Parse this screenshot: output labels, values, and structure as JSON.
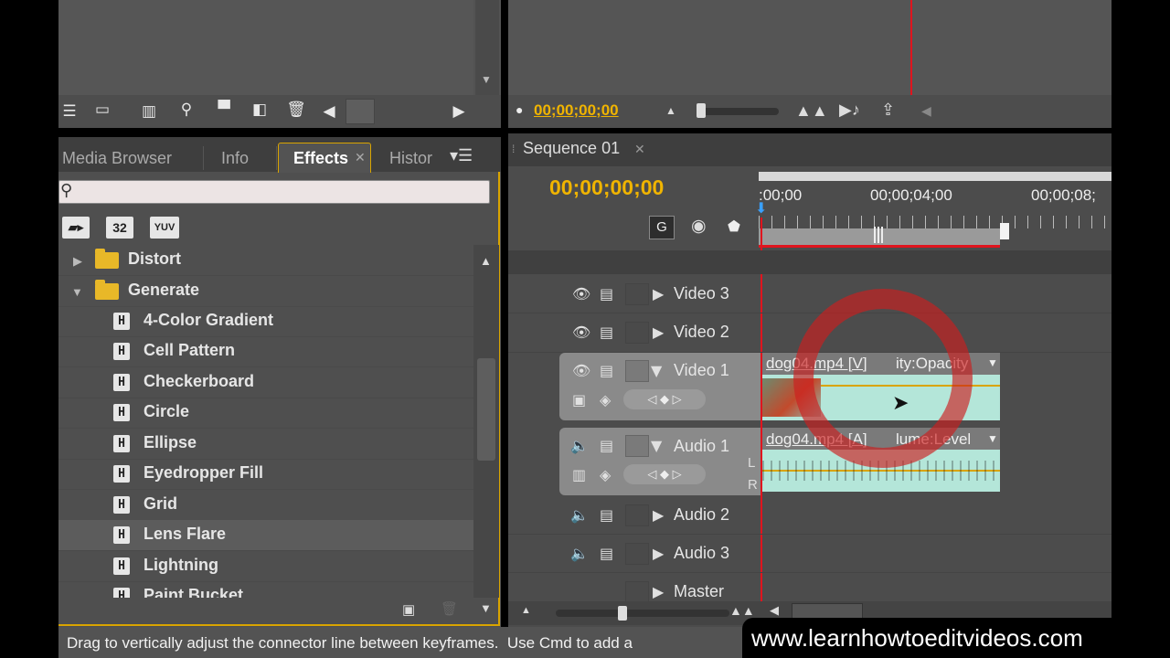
{
  "project_panel": {
    "timecode": "00;00;00;00"
  },
  "effects_panel": {
    "tabs": [
      {
        "label": "Media Browser"
      },
      {
        "label": "Info"
      },
      {
        "label": "Effects"
      },
      {
        "label": "Histor"
      }
    ],
    "active_tab": "Effects",
    "search": {
      "value": "",
      "placeholder": ""
    },
    "filter_buttons": [
      {
        "label": "32"
      },
      {
        "label": "YUV"
      }
    ],
    "folders": [
      {
        "label": "Distort",
        "expanded": false
      },
      {
        "label": "Generate",
        "expanded": true
      }
    ],
    "effects": [
      {
        "label": "4-Color Gradient"
      },
      {
        "label": "Cell Pattern"
      },
      {
        "label": "Checkerboard"
      },
      {
        "label": "Circle"
      },
      {
        "label": "Ellipse"
      },
      {
        "label": "Eyedropper Fill"
      },
      {
        "label": "Grid"
      },
      {
        "label": "Lens Flare"
      },
      {
        "label": "Lightning"
      },
      {
        "label": "Paint Bucket"
      }
    ],
    "selected_effect": "Lens Flare"
  },
  "monitor": {
    "timecode": "00;00;00;00"
  },
  "sequence": {
    "tab_label": "Sequence 01",
    "timecode": "00;00;00;00",
    "ruler_labels": [
      ":00;00",
      "00;00;04;00",
      "00;00;08;"
    ],
    "tracks": {
      "video3": "Video 3",
      "video2": "Video 2",
      "video1": "Video 1",
      "audio1": "Audio 1",
      "audio2": "Audio 2",
      "audio3": "Audio 3",
      "master": "Master"
    },
    "audio_channels": [
      "L",
      "R"
    ],
    "video_clip": {
      "name": "dog04.mp4 [V]",
      "property": "ity:Opacity"
    },
    "audio_clip": {
      "name": "dog04.mp4 [A]",
      "property": "lume:Level"
    }
  },
  "status_bar": {
    "text": "Drag to vertically adjust the connector line between keyframes.  Use Cmd to add a"
  },
  "watermark": "www.learnhowtoeditvideos.com",
  "colors": {
    "accent_timecode": "#f0b400",
    "panel_bg": "#535353",
    "clip_fill": "#9fe0cf",
    "playhead": "#e0141e"
  }
}
